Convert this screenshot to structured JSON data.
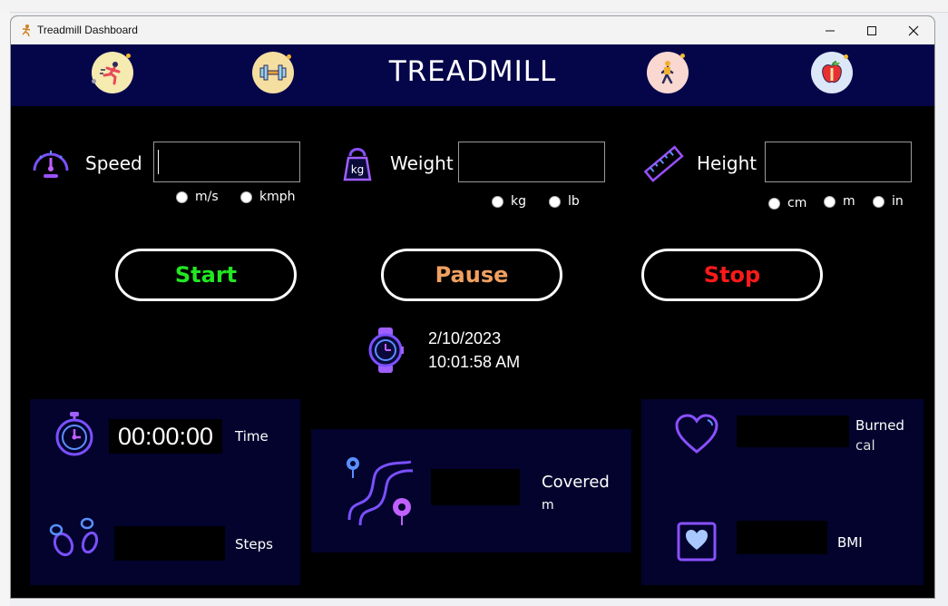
{
  "window": {
    "title": "Treadmill Dashboard"
  },
  "header": {
    "title": "TREADMILL",
    "icons": [
      "running-person-icon",
      "dumbbell-icon",
      "walking-person-icon",
      "apple-icon"
    ]
  },
  "inputs": {
    "speed": {
      "label": "Speed",
      "value": "",
      "units": [
        "m/s",
        "kmph"
      ]
    },
    "weight": {
      "label": "Weight",
      "value": "",
      "units": [
        "kg",
        "lb"
      ],
      "icon_text": "kg"
    },
    "height": {
      "label": "Height",
      "value": "",
      "units": [
        "cm",
        "m",
        "in"
      ]
    }
  },
  "buttons": {
    "start": "Start",
    "pause": "Pause",
    "stop": "Stop"
  },
  "clock": {
    "date": "2/10/2023",
    "time": "10:01:58 AM"
  },
  "stats": {
    "time": {
      "value": "00:00:00",
      "label": "Time"
    },
    "steps": {
      "value": "",
      "label": "Steps"
    },
    "covered": {
      "value": "",
      "label": "Covered",
      "unit": "m"
    },
    "burned": {
      "value": "",
      "label": "Burned",
      "unit": "cal"
    },
    "bmi": {
      "value": "",
      "label": "BMI"
    }
  },
  "colors": {
    "header_bg": "#05054a",
    "panel_bg": "#03032e",
    "start": "#22e622",
    "pause": "#f0a060",
    "stop": "#ff1a1a",
    "accent": "#8a4dff"
  }
}
